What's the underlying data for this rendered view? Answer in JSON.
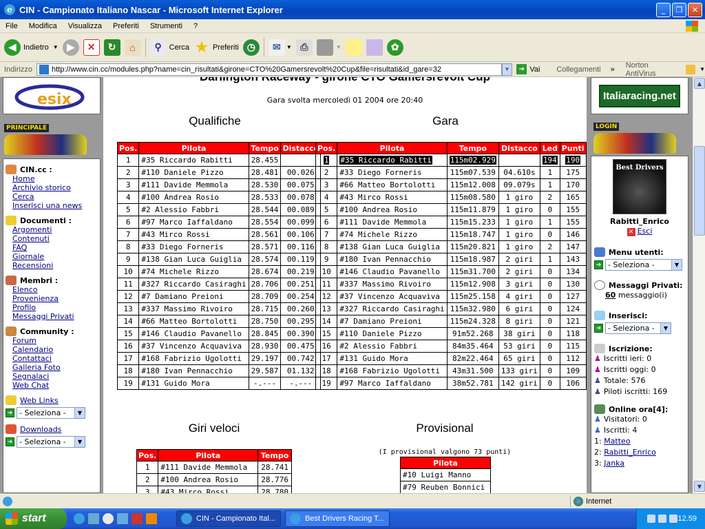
{
  "window": {
    "title": "CIN - Campionato Italiano Nascar - Microsoft Internet Explorer"
  },
  "menu": [
    "File",
    "Modifica",
    "Visualizza",
    "Preferiti",
    "Strumenti",
    "?"
  ],
  "toolbar": {
    "back": "Indietro",
    "search": "Cerca",
    "favorites": "Preferiti"
  },
  "address": {
    "label": "Indirizzo",
    "url": "http://www.cin.cc/modules.php?name=cin_risultati&girone=CTO%20Gamersrevolt%20Cup&file=risultati&id_gare=32",
    "go": "Vai",
    "links": "Collegamenti",
    "antivirus": "Norton AntiVirus"
  },
  "page": {
    "heading_partial": "Darlington Raceway - girone CTO Gamersrevolt Cup",
    "race_info": "Gara svolta mercoledì 01 2004 ore 20:40",
    "qualifiche_title": "Qualifiche",
    "gara_title": "Gara",
    "giri_title": "Giri veloci",
    "prov_title": "Provisional",
    "prov_note": "(I provisional valgono 73 punti)"
  },
  "qualifiche": {
    "headers": [
      "Pos.",
      "Pilota",
      "Tempo",
      "Distacco"
    ],
    "rows": [
      [
        "1",
        "#35 Riccardo Rabitti",
        "28.455",
        ""
      ],
      [
        "2",
        "#110 Daniele Pizzo",
        "28.481",
        "00.026"
      ],
      [
        "3",
        "#111 Davide Memmola",
        "28.530",
        "00.075"
      ],
      [
        "4",
        "#100 Andrea Rosio",
        "28.533",
        "00.078"
      ],
      [
        "5",
        "#2 Alessio Fabbri",
        "28.544",
        "00.089"
      ],
      [
        "6",
        "#97 Marco Iaffaldano",
        "28.554",
        "00.099"
      ],
      [
        "7",
        "#43 Mirco Rossi",
        "28.561",
        "00.106"
      ],
      [
        "8",
        "#33 Diego Forneris",
        "28.571",
        "00.116"
      ],
      [
        "9",
        "#138 Gian Luca Guiglia",
        "28.574",
        "00.119"
      ],
      [
        "10",
        "#74 Michele Rizzo",
        "28.674",
        "00.219"
      ],
      [
        "11",
        "#327 Riccardo Casiraghi",
        "28.706",
        "00.251"
      ],
      [
        "12",
        "#7 Damiano Preioni",
        "28.709",
        "00.254"
      ],
      [
        "13",
        "#337 Massimo Rivoiro",
        "28.715",
        "00.260"
      ],
      [
        "14",
        "#66 Matteo Bortolotti",
        "28.750",
        "00.295"
      ],
      [
        "15",
        "#146 Claudio Pavanello",
        "28.845",
        "00.390"
      ],
      [
        "16",
        "#37 Vincenzo Acquaviva",
        "28.930",
        "00.475"
      ],
      [
        "17",
        "#168 Fabrizio Ugolotti",
        "29.197",
        "00.742"
      ],
      [
        "18",
        "#180 Ivan Pennacchio",
        "29.587",
        "01.132"
      ],
      [
        "19",
        "#131 Guido Mora",
        "-.---",
        "-.---"
      ]
    ]
  },
  "gara": {
    "headers": [
      "Pos.",
      "Pilota",
      "Tempo",
      "Distacco",
      "Led",
      "Punti"
    ],
    "rows": [
      [
        "1",
        "#35 Riccardo Rabitti",
        "115m02.929",
        "",
        "194",
        "190"
      ],
      [
        "2",
        "#33 Diego Forneris",
        "115m07.539",
        "04.610s",
        "1",
        "175"
      ],
      [
        "3",
        "#66 Matteo Bortolotti",
        "115m12.008",
        "09.079s",
        "1",
        "170"
      ],
      [
        "4",
        "#43 Mirco Rossi",
        "115m08.580",
        "1 giro",
        "2",
        "165"
      ],
      [
        "5",
        "#100 Andrea Rosio",
        "115m11.879",
        "1 giro",
        "0",
        "155"
      ],
      [
        "6",
        "#111 Davide Memmola",
        "115m15.233",
        "1 giro",
        "1",
        "155"
      ],
      [
        "7",
        "#74 Michele Rizzo",
        "115m18.747",
        "1 giro",
        "0",
        "146"
      ],
      [
        "8",
        "#138 Gian Luca Guiglia",
        "115m20.821",
        "1 giro",
        "2",
        "147"
      ],
      [
        "9",
        "#180 Ivan Pennacchio",
        "115m18.987",
        "2 giri",
        "1",
        "143"
      ],
      [
        "10",
        "#146 Claudio Pavanello",
        "115m31.700",
        "2 giri",
        "0",
        "134"
      ],
      [
        "11",
        "#337 Massimo Rivoiro",
        "115m12.908",
        "3 giri",
        "0",
        "130"
      ],
      [
        "12",
        "#37 Vincenzo Acquaviva",
        "115m25.158",
        "4 giri",
        "0",
        "127"
      ],
      [
        "13",
        "#327 Riccardo Casiraghi",
        "115m32.980",
        "6 giri",
        "0",
        "124"
      ],
      [
        "14",
        "#7 Damiano Preioni",
        "115m24.328",
        "8 giri",
        "0",
        "121"
      ],
      [
        "15",
        "#110 Daniele Pizzo",
        "91m52.268",
        "38 giri",
        "0",
        "118"
      ],
      [
        "16",
        "#2 Alessio Fabbri",
        "84m35.464",
        "53 giri",
        "0",
        "115"
      ],
      [
        "17",
        "#131 Guido Mora",
        "82m22.464",
        "65 giri",
        "0",
        "112"
      ],
      [
        "18",
        "#168 Fabrizio Ugolotti",
        "43m31.500",
        "133 giri",
        "0",
        "109"
      ],
      [
        "19",
        "#97 Marco Iaffaldano",
        "38m52.781",
        "142 giri",
        "0",
        "106"
      ]
    ]
  },
  "giri": {
    "headers": [
      "Pos.",
      "Pilota",
      "Tempo"
    ],
    "rows": [
      [
        "1",
        "#111 Davide Memmola",
        "28.741"
      ],
      [
        "2",
        "#100 Andrea Rosio",
        "28.776"
      ],
      [
        "3",
        "#43 Mirco Rossi",
        "28.780"
      ]
    ]
  },
  "provisional": {
    "headers": [
      "Pilota"
    ],
    "rows": [
      [
        "#10 Luigi Manno"
      ],
      [
        "#79 Reuben Bonnici"
      ]
    ]
  },
  "left": {
    "logo": "esix",
    "banner": "PRINCIPALE",
    "sections": [
      {
        "title": "CIN.cc :",
        "links": [
          "Home",
          "Archivio storico",
          "Cerca",
          "Inserisci una news"
        ]
      },
      {
        "title": "Documenti :",
        "links": [
          "Argomenti",
          "Contenuti",
          "FAQ",
          "Giornale",
          "Recensioni"
        ]
      },
      {
        "title": "Membri :",
        "links": [
          "Elenco",
          "Provenienza",
          "Profilo",
          "Messaggi Privati"
        ]
      },
      {
        "title": "Community :",
        "links": [
          "Forum",
          "Calendario",
          "Contattaci",
          "Galleria Foto",
          "Segnalaci",
          "Web Chat"
        ]
      }
    ],
    "weblinks": "Web Links",
    "downloads": "Downloads",
    "select": "- Seleziona -"
  },
  "right": {
    "logo": "Italiaracing.net",
    "banner": "LOGIN",
    "avatar_text": "Best Drivers",
    "username": "Rabitti_Enrico",
    "logout": "Esci",
    "menu_utenti": "Menu utenti:",
    "select": "- Seleziona -",
    "messaggi": "Messaggi Privati:",
    "msg_count": "60",
    "msg_suffix": "messaggio(i)",
    "inserisci": "Inserisci:",
    "iscrizione": "Iscrizione:",
    "iscritti_ieri": "Iscritti ieri: 0",
    "iscritti_oggi": "Iscritti oggi: 0",
    "totale": "Totale: 576",
    "piloti": "Piloti iscritti: 169",
    "online": "Online ora[4]:",
    "visitatori": "Visitatori: 0",
    "iscritti": "Iscritti: 4",
    "users": [
      "Matteo",
      "Rabitti_Enrico",
      "Janka"
    ]
  },
  "status": {
    "zone": "Internet"
  },
  "taskbar": {
    "start": "start",
    "tasks": [
      "CIN - Campionato Ital...",
      "Best Drivers Racing T..."
    ],
    "clock": "12.59"
  }
}
